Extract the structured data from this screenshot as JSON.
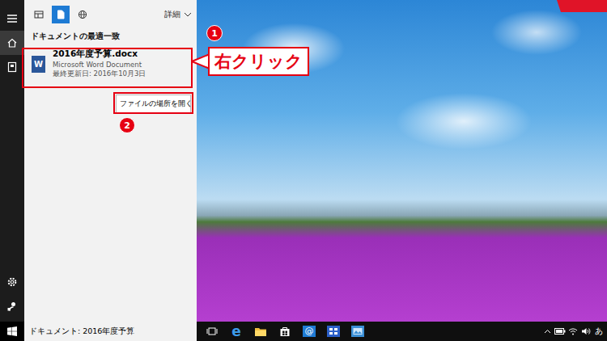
{
  "sidebar": {
    "items": [
      {
        "kind": "menu",
        "selected": false
      },
      {
        "kind": "home",
        "selected": true
      },
      {
        "kind": "notebook",
        "selected": false
      }
    ],
    "bottom": [
      {
        "kind": "settings",
        "selected": false
      },
      {
        "kind": "feedback",
        "selected": false
      }
    ]
  },
  "filters": [
    {
      "kind": "apps",
      "selected": false
    },
    {
      "kind": "documents",
      "selected": true
    },
    {
      "kind": "web",
      "selected": false
    }
  ],
  "details": "詳細",
  "section_header": "ドキュメントの最適一致",
  "result": {
    "icon_letter": "W",
    "title": "2016年度予算.docx",
    "type": "Microsoft Word Document",
    "modified": "最終更新日: 2016年10月3日"
  },
  "context_menu": [
    "ファイルの場所を開く"
  ],
  "annotations": [
    {
      "number": "1"
    },
    {
      "number": "2"
    }
  ],
  "callout": "右クリック",
  "search_box": "ドキュメント: 2016年度予算",
  "taskbar": {
    "apps": [
      {
        "kind": "task-view",
        "glyph": ""
      },
      {
        "kind": "edge",
        "glyph": "e"
      },
      {
        "kind": "explorer",
        "glyph": ""
      },
      {
        "kind": "store",
        "glyph": ""
      },
      {
        "kind": "mail",
        "glyph": "@"
      },
      {
        "kind": "outlook",
        "glyph": ""
      },
      {
        "kind": "photos",
        "glyph": ""
      }
    ],
    "tray": [
      {
        "kind": "chevron"
      },
      {
        "kind": "battery"
      },
      {
        "kind": "network"
      },
      {
        "kind": "volume"
      }
    ],
    "ime": "あ"
  }
}
